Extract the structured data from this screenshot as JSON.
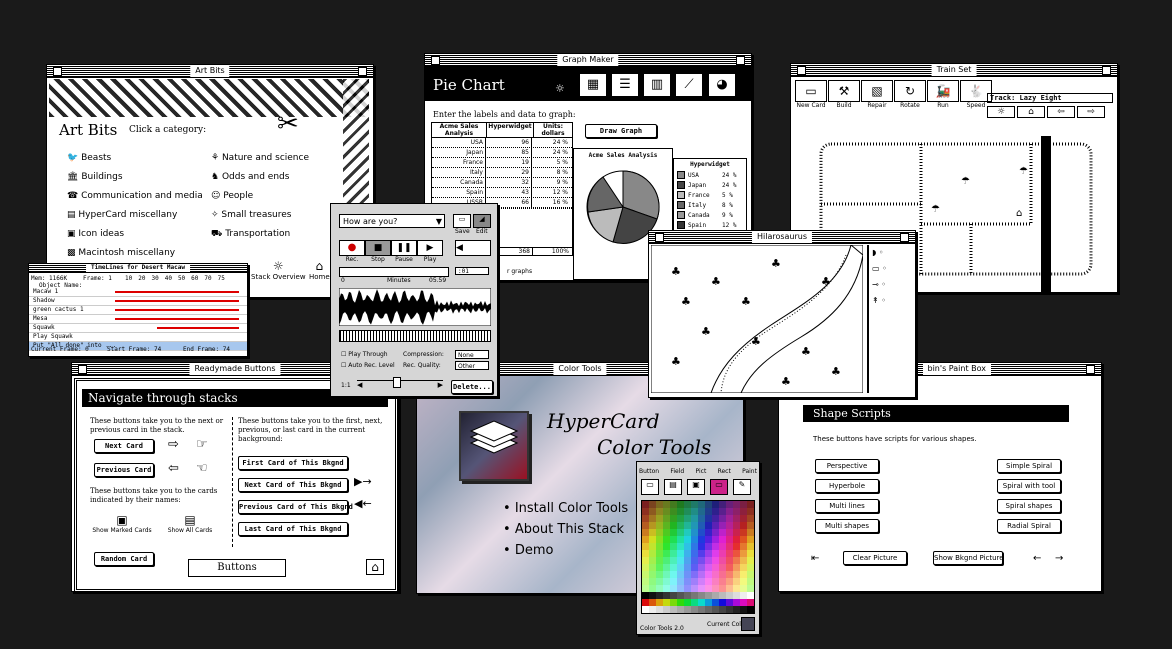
{
  "art_bits": {
    "title": "Art Bits",
    "heading": "Art Bits",
    "prompt": "Click a category:",
    "left": [
      "Beasts",
      "Buildings",
      "Communication and media",
      "HyperCard miscellany",
      "Icon ideas",
      "Macintosh miscellany"
    ],
    "right": [
      "Nature and science",
      "Odds and ends",
      "People",
      "Small treasures",
      "Transportation"
    ],
    "nav": [
      "Stack Overview",
      "Home"
    ]
  },
  "graph_maker": {
    "title": "Graph Maker",
    "heading": "Pie Chart",
    "prompt": "Enter the labels and data to graph:",
    "col1": "Acme Sales Analysis",
    "col2": "Hyperwidget",
    "col3": "Units: dollars",
    "rows": [
      [
        "USA",
        "96",
        "24 %"
      ],
      [
        "Japan",
        "85",
        "24 %"
      ],
      [
        "France",
        "19",
        "5 %"
      ],
      [
        "Italy",
        "29",
        "8 %"
      ],
      [
        "Canada",
        "32",
        "9 %"
      ],
      [
        "Spain",
        "43",
        "12 %"
      ],
      [
        "USSR",
        "66",
        "16 %"
      ]
    ],
    "total": "368",
    "total_pct": "100%",
    "draw_button": "Draw Graph",
    "chart_title": "Acme Sales Analysis",
    "legend_title": "Hyperwidget",
    "legend": [
      [
        "USA",
        "24 %"
      ],
      [
        "Japan",
        "24 %"
      ],
      [
        "France",
        "5 %"
      ],
      [
        "Italy",
        "8 %"
      ],
      [
        "Canada",
        "9 %"
      ],
      [
        "Spain",
        "12 %"
      ]
    ],
    "footer": "r graphs"
  },
  "train_set": {
    "title": "Train Set",
    "track": "Track: Lazy Eight",
    "tools": [
      "New Card",
      "Build",
      "Repair",
      "Rotate",
      "Run",
      "Speed"
    ]
  },
  "timeline": {
    "title": "TimeLines for Desert Macaw",
    "mem": "Mem: 1166K",
    "frame": "Frame: 1",
    "object_name": "Object Name:",
    "ticks": [
      "10",
      "20",
      "30",
      "40",
      "50",
      "60",
      "70",
      "75"
    ],
    "objects": [
      "Macaw 1",
      "Shadow",
      "green cactus 1",
      "Mesa",
      "Squawk",
      "Play Squawk",
      "Put \"All done\" into ..."
    ],
    "current": "Current Frame: 0",
    "start": "Start Frame: 74",
    "end": "End Frame: 74"
  },
  "sound": {
    "question": "How are you?",
    "save": "Save",
    "edit": "Edit",
    "buttons": [
      "Rec.",
      "Stop",
      "Pause",
      "Play"
    ],
    "counter": ":01",
    "min": "0",
    "minutes": "Minutes",
    "max": "05.59",
    "play_through": "Play Through",
    "auto_rec": "Auto Rec. Level",
    "compression": "Compression:",
    "compression_val": "None",
    "rec_quality": "Rec. Quality:",
    "rec_quality_val": "Other",
    "delete": "Delete...",
    "scale": "1:1"
  },
  "hilaro": {
    "title": "Hilarosaurus"
  },
  "buttons_stack": {
    "title": "Readymade Buttons",
    "heading": "Navigate through stacks",
    "text1": "These buttons take you to the next or previous card in the stack.",
    "next": "Next Card",
    "prev": "Previous Card",
    "text2": "These buttons take you to the cards indicated by their names:",
    "show_marked": "Show Marked Cards",
    "show_all": "Show All Cards",
    "random": "Random Card",
    "text3": "These buttons take you to the first, next, previous, or last card in the current background:",
    "first_bg": "First Card of This Bkgnd",
    "next_bg": "Next Card of This Bkgnd",
    "prev_bg": "Previous Card of This Bkgnd",
    "last_bg": "Last Card of This Bkgnd",
    "banner": "Buttons"
  },
  "color_tools": {
    "title": "Color Tools",
    "line1": "HyperCard",
    "line2": "Color Tools",
    "items": [
      "Install Color Tools",
      "About This Stack",
      "Demo"
    ]
  },
  "palette": {
    "tabs": [
      "Button",
      "Field",
      "Pict",
      "Rect",
      "Paint"
    ],
    "footer": "Color Tools 2.0",
    "current": "Current Color:"
  },
  "paint_box": {
    "title": "bin's Paint Box",
    "heading": "Shape Scripts",
    "text": "These buttons have scripts for various shapes.",
    "left": [
      "Perspective",
      "Hyperbole",
      "Multi lines",
      "Multi shapes"
    ],
    "right": [
      "Simple Spiral",
      "Spiral with tool",
      "Spiral shapes",
      "Radial Spiral"
    ],
    "clear": "Clear Picture",
    "show_bg": "Show Bkgnd Picture"
  }
}
